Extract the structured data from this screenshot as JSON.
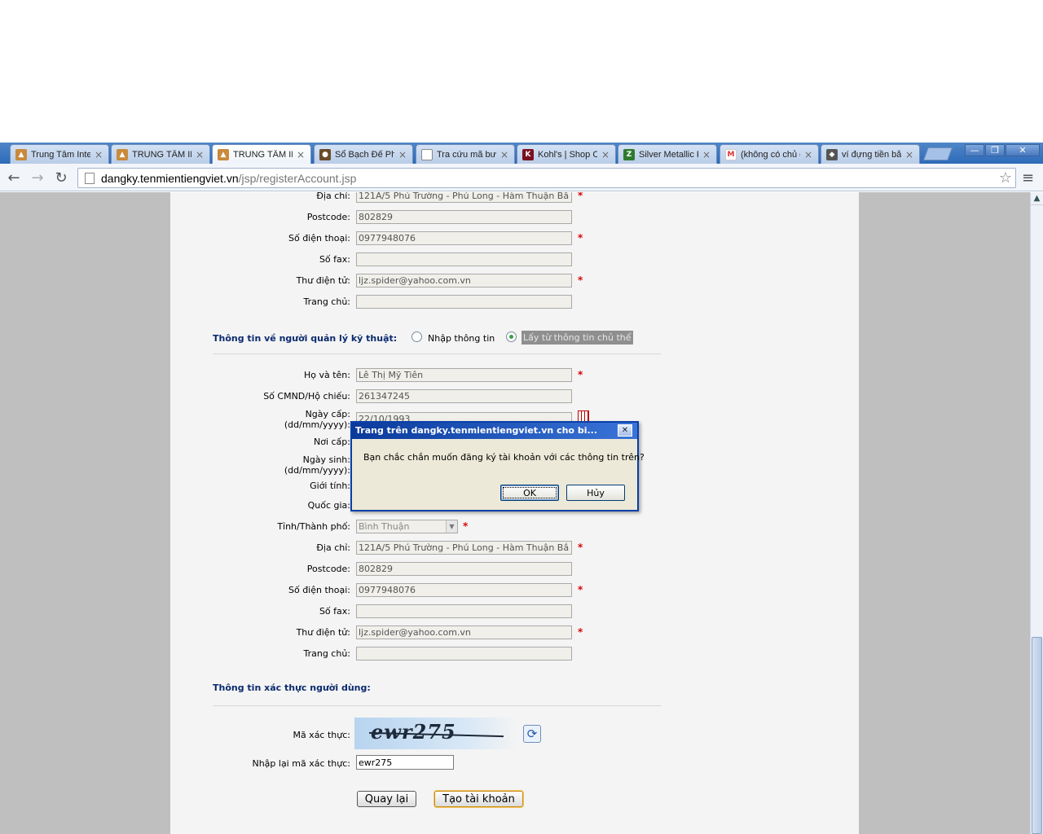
{
  "browser": {
    "tabs": [
      {
        "label": "Trung Tâm Inte",
        "active": false
      },
      {
        "label": "TRUNG TÂM IN",
        "active": false
      },
      {
        "label": "TRUNG TÂM IN",
        "active": true
      },
      {
        "label": "Sổ Bạch Đế Phi",
        "active": false
      },
      {
        "label": "Tra cứu mã bưu",
        "active": false
      },
      {
        "label": "Kohl's | Shop Cl",
        "active": false
      },
      {
        "label": "Silver Metallic R",
        "active": false
      },
      {
        "label": "(không có chủ đ",
        "active": false
      },
      {
        "label": "ví đựng tiền bằn",
        "active": false
      }
    ],
    "url_host": "dangky.tenmientiengviet.vn",
    "url_path": "/jsp/registerAccount.jsp"
  },
  "form": {
    "owner": {
      "address_label": "Địa chỉ:",
      "address_value": "121A/5 Phú Trường - Phú Long - Hàm Thuận Bắ",
      "postcode_label": "Postcode:",
      "postcode_value": "802829",
      "phone_label": "Số điện thoại:",
      "phone_value": "0977948076",
      "fax_label": "Số fax:",
      "fax_value": "",
      "email_label": "Thư điện tử:",
      "email_value": "ljz.spider@yahoo.com.vn",
      "homepage_label": "Trang chủ:",
      "homepage_value": ""
    },
    "tech_section_title": "Thông tin về người quản lý kỹ thuật:",
    "radio_manual_label": "Nhập thông tin",
    "radio_copy_label": "Lấy từ thông tin chủ thể",
    "tech": {
      "name_label": "Họ và tên:",
      "name_value": "Lê Thị Mỹ Tiên",
      "id_label": "Số CMND/Hộ chiếu:",
      "id_value": "261347245",
      "issue_date_label": "Ngày cấp:",
      "issue_date_format": "(dd/mm/yyyy):",
      "issue_date_value": "22/10/1993",
      "issue_place_label": "Nơi cấp:",
      "birth_label": "Ngày sinh:",
      "birth_format": "(dd/mm/yyyy):",
      "gender_label": "Giới tính:",
      "country_label": "Quốc gia:",
      "province_label": "Tỉnh/Thành phố:",
      "province_value": "Bình Thuận",
      "address_label": "Địa chỉ:",
      "address_value": "121A/5 Phú Trường - Phú Long - Hàm Thuận Bắ",
      "postcode_label": "Postcode:",
      "postcode_value": "802829",
      "phone_label": "Số điện thoại:",
      "phone_value": "0977948076",
      "fax_label": "Số fax:",
      "fax_value": "",
      "email_label": "Thư điện tử:",
      "email_value": "ljz.spider@yahoo.com.vn",
      "homepage_label": "Trang chủ:",
      "homepage_value": ""
    },
    "auth_section_title": "Thông tin xác thực người dùng:",
    "captcha_label": "Mã xác thực:",
    "captcha_image_text": "ewr275",
    "captcha_reenter_label": "Nhập lại mã xác thực:",
    "captcha_reenter_value": "ewr275",
    "back_button": "Quay lại",
    "create_button": "Tạo tài khoản"
  },
  "dialog": {
    "title": "Trang trên dangky.tenmientiengviet.vn cho bi...",
    "message": "Bạn chắc chắn muốn đăng ký tài khoản với các thông tin trên?",
    "ok": "OK",
    "cancel": "Hủy"
  }
}
